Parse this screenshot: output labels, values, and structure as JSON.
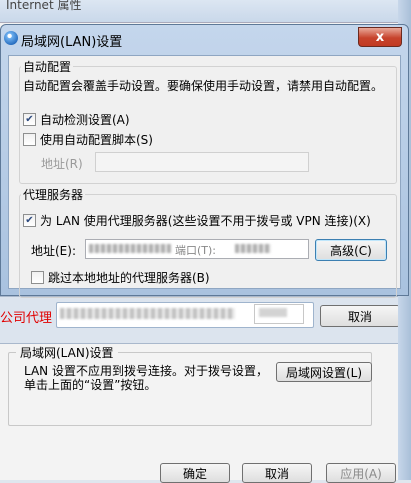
{
  "background_window": {
    "title_partial": "Internet 属性",
    "lan_group_title": "局域网(LAN)设置",
    "lan_description": "LAN 设置不应用到拨号连接。对于拨号设置，单击上面的“设置”按钮。",
    "lan_settings_button": "局域网设置(L)",
    "ok_button": "确定",
    "cancel_button": "取消",
    "apply_button": "应用(A)"
  },
  "proxy_dialog": {
    "label": "公司代理",
    "address_value": "",
    "cancel_button": "取消"
  },
  "dialog": {
    "title": "局域网(LAN)设置",
    "close_glyph": "x",
    "auto_config": {
      "group_title": "自动配置",
      "description": "自动配置会覆盖手动设置。要确保使用手动设置，请禁用自动配置。",
      "auto_detect_label": "自动检测设置(A)",
      "auto_detect_checked": true,
      "use_script_label": "使用自动配置脚本(S)",
      "use_script_checked": false,
      "address_label": "地址(R)",
      "address_value": ""
    },
    "proxy_server": {
      "group_title": "代理服务器",
      "use_proxy_label": "为 LAN 使用代理服务器(这些设置不用于拨号或 VPN 连接)(X)",
      "use_proxy_checked": true,
      "address_label": "地址(E):",
      "port_label": "端口(T):",
      "advanced_button": "高级(C)",
      "bypass_local_label": "跳过本地地址的代理服务器(B)",
      "bypass_local_checked": false
    }
  }
}
